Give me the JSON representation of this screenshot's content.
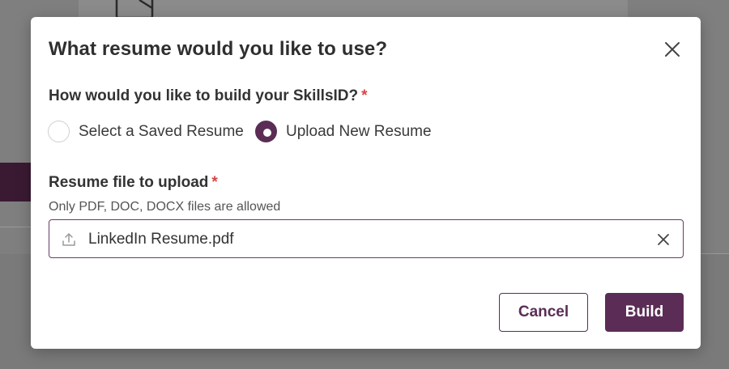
{
  "modal": {
    "title": "What resume would you like to use?",
    "question_label": "How would you like to build your SkillsID?",
    "required_mark": "*",
    "options": [
      {
        "label": "Select a Saved Resume",
        "selected": false
      },
      {
        "label": "Upload New Resume",
        "selected": true
      }
    ],
    "file_field": {
      "label": "Resume file to upload",
      "required_mark": "*",
      "hint": "Only PDF, DOC, DOCX files are allowed",
      "value": "LinkedIn Resume.pdf"
    },
    "buttons": {
      "cancel": "Cancel",
      "build": "Build"
    }
  },
  "colors": {
    "accent": "#5b2d56",
    "required": "#d64545",
    "overlay": "#7f7f7f"
  },
  "icons": {
    "close": "close-icon",
    "upload": "upload-icon",
    "clear": "clear-icon",
    "background_doc": "document-icon"
  }
}
